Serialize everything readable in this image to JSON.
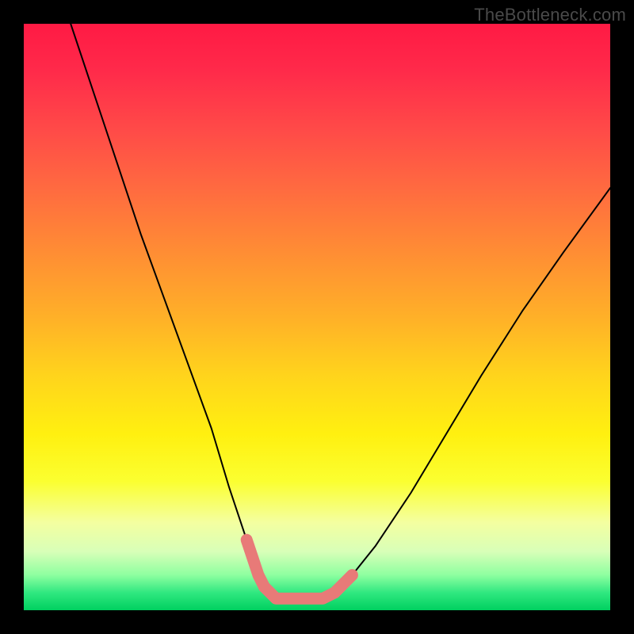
{
  "watermark": "TheBottleneck.com",
  "chart_data": {
    "type": "line",
    "title": "",
    "xlabel": "",
    "ylabel": "",
    "xlim": [
      0,
      100
    ],
    "ylim": [
      0,
      100
    ],
    "series": [
      {
        "name": "bottleneck-curve",
        "x": [
          8,
          12,
          16,
          20,
          24,
          28,
          32,
          35,
          38,
          40,
          42,
          44,
          47,
          50,
          53,
          56,
          60,
          66,
          72,
          78,
          85,
          92,
          100
        ],
        "y": [
          100,
          88,
          76,
          64,
          53,
          42,
          31,
          21,
          12,
          6,
          3,
          2,
          2,
          2,
          3,
          6,
          11,
          20,
          30,
          40,
          51,
          61,
          72
        ]
      }
    ],
    "highlights": {
      "name": "optimal-band",
      "color": "#e87a78",
      "segments": [
        {
          "x": [
            38,
            39,
            40,
            41
          ],
          "y": [
            12,
            9,
            6,
            4
          ]
        },
        {
          "x": [
            41,
            43,
            45,
            47,
            49,
            51,
            53
          ],
          "y": [
            4,
            2,
            2,
            2,
            2,
            2,
            3
          ]
        },
        {
          "x": [
            53,
            54,
            55,
            56
          ],
          "y": [
            3,
            4,
            5,
            6
          ]
        }
      ]
    }
  }
}
